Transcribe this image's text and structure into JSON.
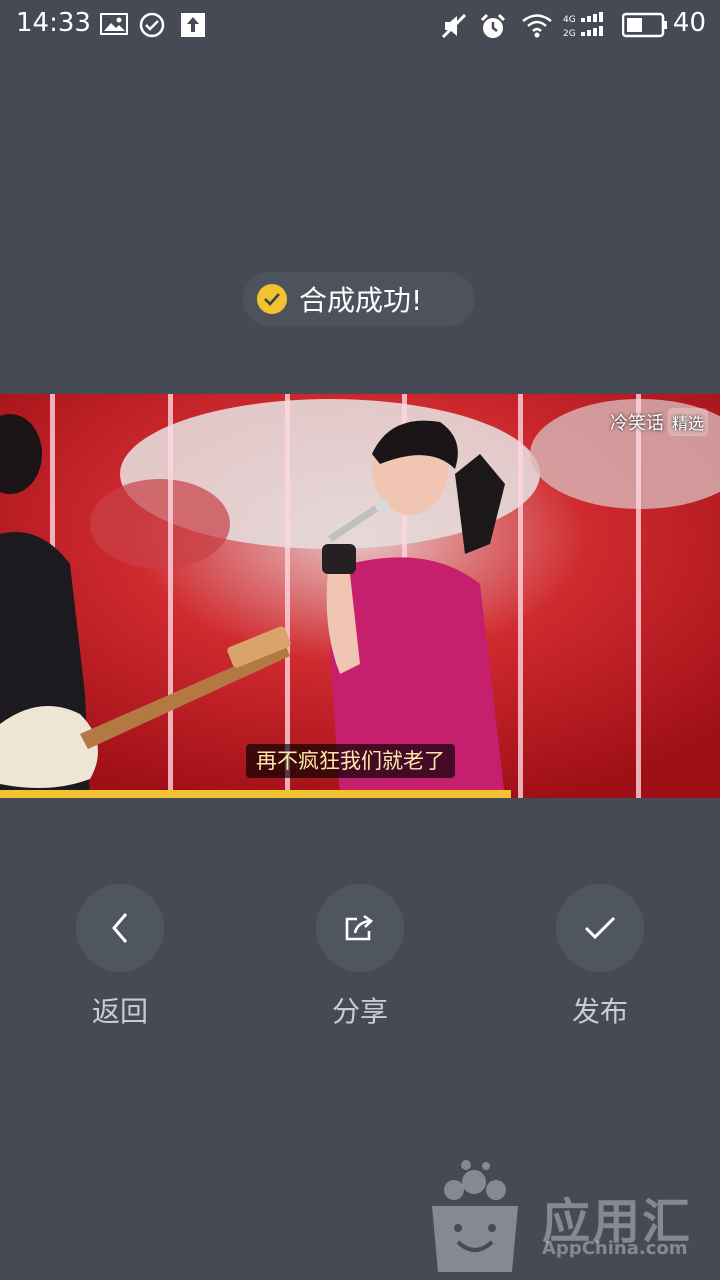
{
  "status_bar": {
    "time": "14:33",
    "battery": "40",
    "icons": [
      "image-icon",
      "check-circle-icon",
      "upload-icon",
      "mute-icon",
      "alarm-icon",
      "wifi-icon",
      "signal-icon",
      "battery-icon"
    ]
  },
  "toast": {
    "text": "合成成功!"
  },
  "video": {
    "watermark": "冷笑话",
    "watermark_tag": "精选",
    "subtitle": "再不疯狂我们就老了",
    "progress": 0.71
  },
  "actions": {
    "back": "返回",
    "share": "分享",
    "publish": "发布"
  },
  "brand": {
    "name": "应用汇",
    "site": "AppChina.com"
  },
  "colors": {
    "accent": "#f2c230",
    "background": "#454a54"
  }
}
